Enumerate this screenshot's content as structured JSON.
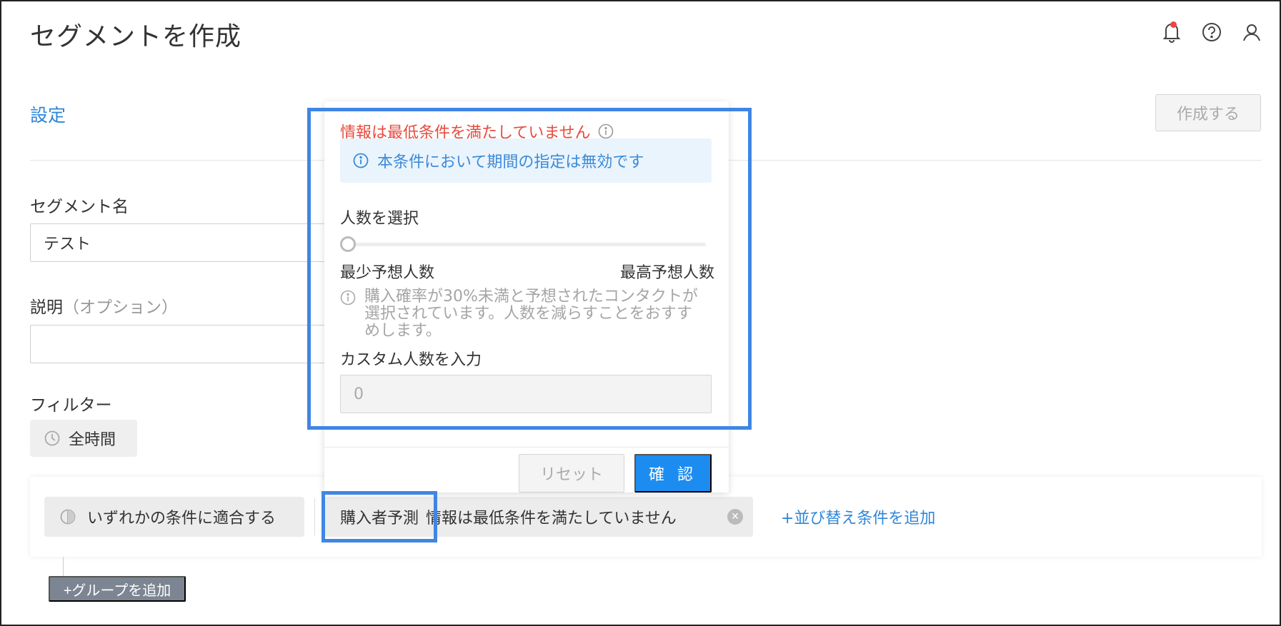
{
  "page": {
    "title": "セグメントを作成"
  },
  "header": {
    "icons": [
      "bell-icon",
      "help-icon",
      "user-icon"
    ],
    "notification_color": "#f04646"
  },
  "settings": {
    "link": "設定",
    "create_button": "作成する"
  },
  "form": {
    "segment_name_label": "セグメント名",
    "segment_name_value": "テスト",
    "description_label": "説明",
    "description_optional": "（オプション）",
    "description_value": "",
    "filter_label": "フィルター",
    "time_chip": "全時間"
  },
  "filter_row": {
    "match_label": "いずれかの条件に適合する",
    "condition_type": "購入者予測",
    "condition_text": "情報は最低条件を満たしていません",
    "add_sort_link": "+並び替え条件を追加"
  },
  "add_group_button": "+グループを追加",
  "popup": {
    "warning_title": "情報は最低条件を満たしていません",
    "info_banner": "本条件において期間の指定は無効です",
    "select_label": "人数を選択",
    "slider_value": 0,
    "min_label": "最少予想人数",
    "max_label": "最高予想人数",
    "hint": "購入確率が30%未満と予想されたコンタクトが選択されています。人数を減らすことをおすすめします。",
    "custom_label": "カスタム人数を入力",
    "custom_placeholder": "0",
    "reset_button": "リセット",
    "confirm_button": "確 認"
  },
  "colors": {
    "accent": "#2f86d8",
    "confirm": "#1d8cf0",
    "warning": "#e84b3c",
    "highlight": "#3f86e4"
  }
}
